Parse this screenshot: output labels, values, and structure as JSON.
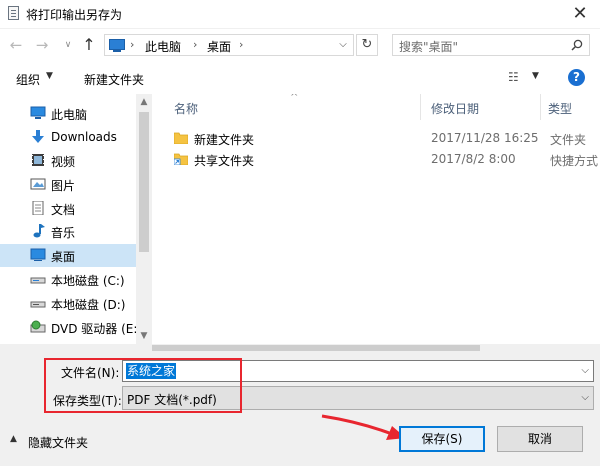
{
  "window": {
    "title": "将打印输出另存为",
    "close": "✕"
  },
  "address": {
    "crumbs": [
      "此电脑",
      "桌面"
    ],
    "separator": "›",
    "dropdown": "⌵",
    "refresh": "↻"
  },
  "search": {
    "placeholder": "搜索\"桌面\""
  },
  "toolbar": {
    "organize": "组织",
    "new_folder": "新建文件夹",
    "help": "?"
  },
  "nav_pane": {
    "items": [
      {
        "label": "此电脑",
        "icon": "computer-icon"
      },
      {
        "label": "Downloads",
        "icon": "download-icon"
      },
      {
        "label": "视频",
        "icon": "video-icon"
      },
      {
        "label": "图片",
        "icon": "pictures-icon"
      },
      {
        "label": "文档",
        "icon": "documents-icon"
      },
      {
        "label": "音乐",
        "icon": "music-icon"
      },
      {
        "label": "桌面",
        "icon": "desktop-icon",
        "selected": true
      },
      {
        "label": "本地磁盘 (C:)",
        "icon": "drive-icon"
      },
      {
        "label": "本地磁盘 (D:)",
        "icon": "drive-icon"
      },
      {
        "label": "DVD 驱动器 (E:",
        "icon": "dvd-icon"
      }
    ]
  },
  "file_list": {
    "columns": {
      "name": "名称",
      "date": "修改日期",
      "type": "类型"
    },
    "rows": [
      {
        "name": "新建文件夹",
        "date": "2017/11/28 16:25",
        "type": "文件夹",
        "icon": "folder-icon"
      },
      {
        "name": "共享文件夹",
        "date": "2017/8/2 8:00",
        "type": "快捷方式",
        "icon": "shortcut-folder-icon"
      }
    ]
  },
  "save_form": {
    "filename_label": "文件名(N):",
    "filename_value": "系统之家",
    "filetype_label": "保存类型(T):",
    "filetype_value": "PDF 文档(*.pdf)"
  },
  "footer": {
    "hide_folders": "隐藏文件夹",
    "save": "保存(S)",
    "cancel": "取消"
  },
  "colors": {
    "accent": "#0078d7",
    "annotation": "#e8262f",
    "selection": "#cce4f7"
  }
}
